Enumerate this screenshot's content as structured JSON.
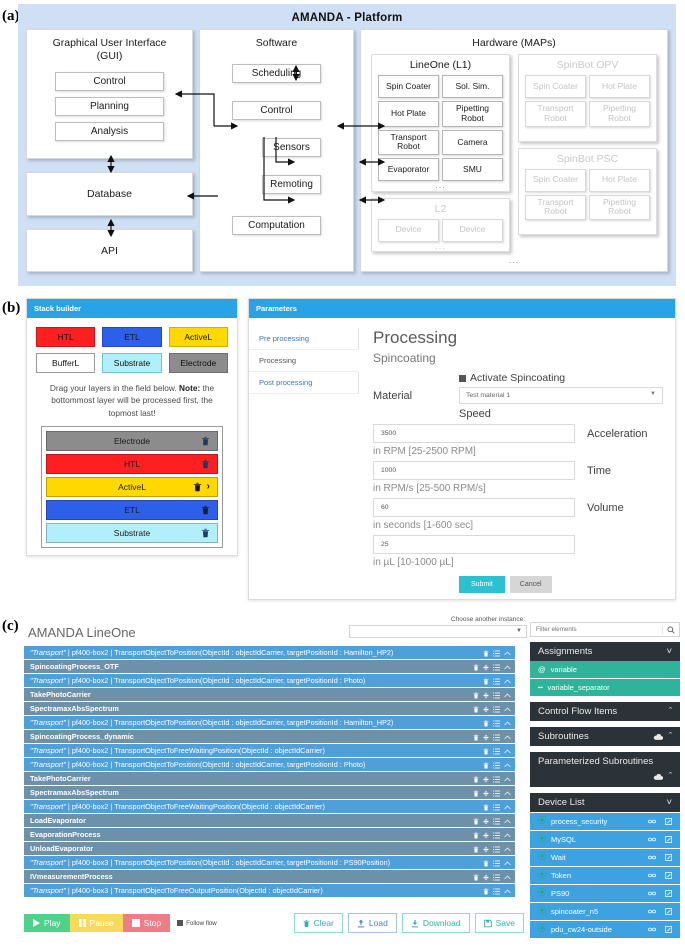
{
  "panels": {
    "a": "(a)",
    "b": "(b)",
    "c": "(c)"
  },
  "figure_a": {
    "title": "AMANDA - Platform",
    "gui": {
      "header_line1": "Graphical User Interface",
      "header_line2": "(GUI)",
      "nodes": [
        "Control",
        "Planning",
        "Analysis"
      ]
    },
    "database": "Database",
    "api": "API",
    "software": {
      "header": "Software",
      "nodes": [
        "Scheduling",
        "Control",
        "Sensors",
        "Remoting",
        "Computation"
      ]
    },
    "hardware": {
      "header": "Hardware (MAPs)",
      "maps": [
        {
          "name": "LineOne (L1)",
          "ghost": false,
          "devices": [
            "Spin Coater",
            "Sol. Sim.",
            "Hot Plate",
            "Pipetting Robot",
            "Transport Robot",
            "Camera",
            "Evaporator",
            "SMU"
          ],
          "ellipsis": "..."
        },
        {
          "name": "L2",
          "ghost": true,
          "devices": [
            "Device",
            "Device"
          ],
          "ellipsis": "..."
        },
        {
          "name": "SpinBot OPV",
          "ghost": true,
          "devices": [
            "Spin Coater",
            "Hot Plate",
            "Transport Robot",
            "Pipetting Robot"
          ],
          "ellipsis": ""
        },
        {
          "name": "SpinBot PSC",
          "ghost": true,
          "devices": [
            "Spin Coater",
            "Hot Plate",
            "Transport Robot",
            "Pipetting Robot"
          ],
          "ellipsis": ""
        }
      ],
      "bottom_ellipsis": "..."
    }
  },
  "figure_b": {
    "stack_builder": {
      "header": "Stack builder",
      "palette": [
        {
          "label": "HTL",
          "color": "#fe2020"
        },
        {
          "label": "ETL",
          "color": "#2e5fe8"
        },
        {
          "label": "ActiveL",
          "color": "#ffd800"
        },
        {
          "label": "BufferL",
          "color": "#ffffff"
        },
        {
          "label": "Substrate",
          "color": "#b1f0fb"
        },
        {
          "label": "Electrode",
          "color": "#8c8c8c"
        }
      ],
      "note_prefix": "Drag your layers in the field below. ",
      "note_bold": "Note:",
      "note_suffix": " the bottommost layer will be processed first, the topmost last!",
      "layers": [
        {
          "label": "Electrode",
          "color": "#8c8c8c",
          "expandable": false
        },
        {
          "label": "HTL",
          "color": "#fe2020",
          "expandable": false
        },
        {
          "label": "ActiveL",
          "color": "#ffd800",
          "expandable": true
        },
        {
          "label": "ETL",
          "color": "#2e5fe8",
          "expandable": false
        },
        {
          "label": "Substrate",
          "color": "#b1f0fb",
          "expandable": false
        }
      ]
    },
    "parameters": {
      "header": "Parameters",
      "tabs": [
        {
          "label": "Pre processing",
          "active": false
        },
        {
          "label": "Processing",
          "active": true
        },
        {
          "label": "Post processing",
          "active": false
        }
      ],
      "heading": "Processing",
      "subheading": "Spincoating",
      "activate_label": "Activate Spincoating",
      "material_label": "Material",
      "material_value": "Test material 1",
      "speed_label": "Speed",
      "fields": [
        {
          "value": "3500",
          "right_label": "Acceleration",
          "hint": "in RPM [25-2500 RPM]"
        },
        {
          "value": "1000",
          "right_label": "Time",
          "hint": "in RPM/s [25-500 RPM/s]"
        },
        {
          "value": "60",
          "right_label": "Volume",
          "hint": "in seconds [1-600 sec]"
        },
        {
          "value": "25",
          "right_label": "",
          "hint": "in µL [10-1000 µL]"
        }
      ],
      "submit_label": "Submit",
      "cancel_label": "Cancel",
      "accent_color": "#29a3e8",
      "submit_color": "#2cc0d0"
    }
  },
  "figure_c": {
    "title": "AMANDA LineOne",
    "instance_label": "Choose another instance:",
    "instance_value": "",
    "sequence": [
      {
        "type": "transport",
        "quoted": "\"Transport\"",
        "rest": " | pf400-box2 | TransportObjectToPosition(ObjectId : objectIdCarrier, targetPositionId : Hamilton_HP2)"
      },
      {
        "type": "process",
        "quoted": "",
        "rest": "SpincoatingProcess_OTF"
      },
      {
        "type": "transport",
        "quoted": "\"Transport\"",
        "rest": " | pf400-box2 | TransportObjectToPosition(ObjectId : objectIdCarrier, targetPositionId : Photo)"
      },
      {
        "type": "process",
        "quoted": "",
        "rest": "TakePhotoCarrier"
      },
      {
        "type": "process",
        "quoted": "",
        "rest": "SpectramaxAbsSpectrum"
      },
      {
        "type": "transport",
        "quoted": "\"Transport\"",
        "rest": " | pf400-box2 | TransportObjectToPosition(ObjectId : objectIdCarrier, targetPositionId : Hamilton_HP2)"
      },
      {
        "type": "process",
        "quoted": "",
        "rest": "SpincoatingProcess_dynamic"
      },
      {
        "type": "transport",
        "quoted": "\"Transport\"",
        "rest": " | pf400-box2 | TransportObjectToFreeWaitingPosition(ObjectId : objectIdCarrier)"
      },
      {
        "type": "transport",
        "quoted": "\"Transport\"",
        "rest": " | pf400-box2 | TransportObjectToPosition(ObjectId : objectIdCarrier, targetPositionId : Photo)"
      },
      {
        "type": "process",
        "quoted": "",
        "rest": "TakePhotoCarrier"
      },
      {
        "type": "process",
        "quoted": "",
        "rest": "SpectramaxAbsSpectrum"
      },
      {
        "type": "transport",
        "quoted": "\"Transport\"",
        "rest": " | pf400-box2 | TransportObjectToFreeWaitingPosition(ObjectId : objectIdCarrier)"
      },
      {
        "type": "process",
        "quoted": "",
        "rest": "LoadEvaporator"
      },
      {
        "type": "process",
        "quoted": "",
        "rest": "EvaporationProcess"
      },
      {
        "type": "process",
        "quoted": "",
        "rest": "UnloadEvaporator"
      },
      {
        "type": "transport",
        "quoted": "\"Transport\"",
        "rest": " | pf400-box3 | TransportObjectToPosition(ObjectId : objectIdCarrier, targetPositionId : PS90Position)"
      },
      {
        "type": "process",
        "quoted": "",
        "rest": "IVmeasurementProcess"
      },
      {
        "type": "transport",
        "quoted": "\"Transport\"",
        "rest": " | pf400-box3 | TransportObjectToFreeOutputPosition(ObjectId : objectIdCarrier)"
      }
    ],
    "sidebar": {
      "filter_placeholder": "Filter elements",
      "sections": [
        {
          "label": "Assignments",
          "chevron": "v",
          "cloud": false
        },
        {
          "label": "Control Flow Items",
          "chevron": "^",
          "cloud": false
        },
        {
          "label": "Subroutines",
          "chevron": "^",
          "cloud": true
        },
        {
          "label": "Parameterized Subroutines",
          "chevron": "^",
          "cloud": true
        },
        {
          "label": "Device List",
          "chevron": "v",
          "cloud": false
        }
      ],
      "assignment_items": [
        {
          "icon": "@",
          "label": "variable"
        },
        {
          "icon": "—",
          "label": "variable_separator"
        }
      ],
      "devices": [
        "process_security",
        "MySQL",
        "Wait",
        "Token",
        "PS90",
        "spincoater_n5",
        "pdu_cw24-outside"
      ]
    },
    "toolbar": {
      "play": "Play",
      "pause": "Pause",
      "stop": "Stop",
      "follow": "Follow flow",
      "clear": "Clear",
      "load": "Load",
      "download": "Download",
      "save": "Save"
    }
  }
}
